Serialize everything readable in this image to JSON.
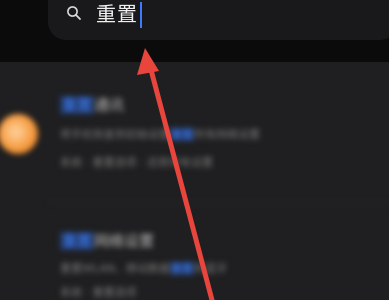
{
  "search": {
    "query": "重置",
    "icon": "search-icon"
  },
  "colors": {
    "accent": "#3a7bff",
    "annotation_arrow": "#e8453c"
  },
  "results": [
    {
      "title_highlight": "重置",
      "title_rest": "通讯",
      "line1_pre": "将手机恢复到初始设置",
      "line1_hl": "重置",
      "line1_post": "所有网络设置",
      "line2": "系统 · 重置选项 · 还原所有设置"
    },
    {
      "title_highlight": "重置",
      "title_rest": "网络设置",
      "line1_pre": "重置WLAN、移动数据",
      "line1_hl": "重置",
      "line1_post": "和蓝牙",
      "line2": "系统 · 重置选项"
    }
  ]
}
